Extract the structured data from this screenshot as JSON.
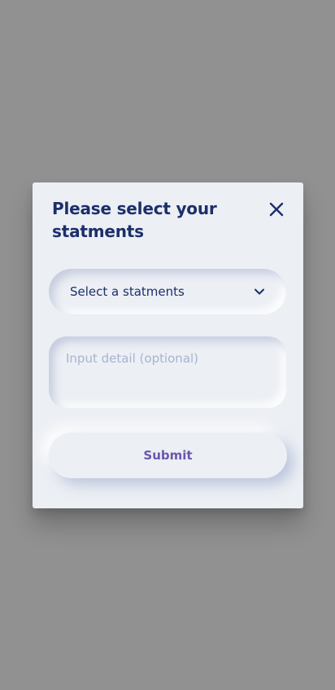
{
  "dialog": {
    "title": "Please select your statments",
    "close_icon": "close-icon"
  },
  "select": {
    "value": "Select a statments",
    "icon": "chevron-down-icon"
  },
  "detail": {
    "placeholder": "Input detail (optional)",
    "value": ""
  },
  "submit": {
    "label": "Submit"
  },
  "colors": {
    "backdrop": "#919191",
    "surface": "#eceff4",
    "title": "#1c2f6b",
    "placeholder": "#a8b4cf",
    "accent": "#6a56b0"
  }
}
